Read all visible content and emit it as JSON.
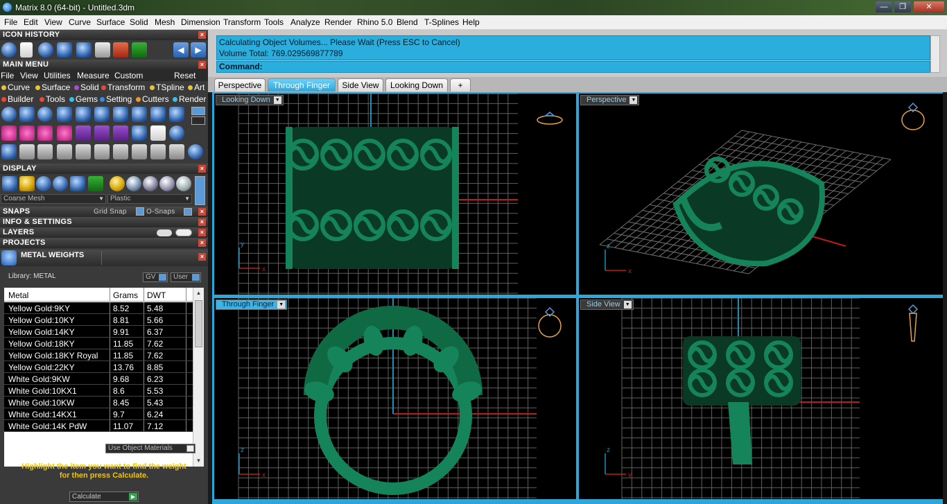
{
  "window": {
    "title": "Matrix 8.0 (64-bit) - Untitled.3dm",
    "controls": {
      "minimize": "—",
      "maximize": "❐",
      "close": "✕"
    }
  },
  "menubar": [
    "File",
    "Edit",
    "View",
    "Curve",
    "Surface",
    "Solid",
    "Mesh",
    "Dimension",
    "Transform",
    "Tools",
    "Analyze",
    "Render",
    "Rhino 5.0",
    "Blend",
    "T-Splines",
    "Help"
  ],
  "panels": {
    "icon_history": "ICON HISTORY",
    "main_menu": "MAIN MENU",
    "main_menu_items": [
      "File",
      "View",
      "Utilities",
      "Measure",
      "Custom"
    ],
    "reset": "Reset",
    "categories_row1": [
      {
        "label": "Curve",
        "color": "#e8c23a"
      },
      {
        "label": "Surface",
        "color": "#e8c23a"
      },
      {
        "label": "Solid",
        "color": "#b04ad0"
      },
      {
        "label": "Transform",
        "color": "#e84a3a"
      },
      {
        "label": "TSpline",
        "color": "#e8c23a"
      },
      {
        "label": "Art",
        "color": "#e8c23a"
      }
    ],
    "categories_row2": [
      {
        "label": "Builder",
        "color": "#e84a3a"
      },
      {
        "label": "Tools",
        "color": "#e84a3a"
      },
      {
        "label": "Gems",
        "color": "#3ac0e8"
      },
      {
        "label": "Setting",
        "color": "#3a8ae8"
      },
      {
        "label": "Cutters",
        "color": "#e89a3a"
      },
      {
        "label": "Render",
        "color": "#3ac0e8"
      }
    ],
    "display": "DISPLAY",
    "mesh_mode": "Coarse Mesh",
    "material_mode": "Plastic",
    "snaps": "SNAPS",
    "grid_snap": "Grid Snap",
    "o_snaps": "O-Snaps",
    "info_settings": "INFO & SETTINGS",
    "layers": "LAYERS",
    "projects": "PROJECTS",
    "metal_weights": "METAL WEIGHTS"
  },
  "metal_weights": {
    "library_label": "Library: METAL",
    "gv_label": "GV",
    "user_label": "User",
    "columns": [
      "Metal",
      "Grams",
      "DWT"
    ],
    "rows": [
      [
        "Yellow Gold:9KY",
        "8.52",
        "5.48"
      ],
      [
        "Yellow Gold:10KY",
        "8.81",
        "5.66"
      ],
      [
        "Yellow Gold:14KY",
        "9.91",
        "6.37"
      ],
      [
        "Yellow Gold:18KY",
        "11.85",
        "7.62"
      ],
      [
        "Yellow Gold:18KY Royal",
        "11.85",
        "7.62"
      ],
      [
        "Yellow Gold:22KY",
        "13.76",
        "8.85"
      ],
      [
        "White Gold:9KW",
        "9.68",
        "6.23"
      ],
      [
        "White Gold:10KX1",
        "8.6",
        "5.53"
      ],
      [
        "White Gold:10KW",
        "8.45",
        "5.43"
      ],
      [
        "White Gold:14KX1",
        "9.7",
        "6.24"
      ],
      [
        "White Gold:14K PdW",
        "11.07",
        "7.12"
      ]
    ],
    "use_object_materials": "Use Object Materials",
    "hint_line1": "Highlight the item you want to find the weight",
    "hint_line2": "for then press Calculate.",
    "calculate": "Calculate"
  },
  "command": {
    "line1": "Calculating Object Volumes... Please Wait (Press ESC to Cancel)",
    "line2": "Volume Total: 769.029569877789",
    "prompt": "Command:"
  },
  "tabs": [
    {
      "label": "Perspective",
      "active": false
    },
    {
      "label": "Through Finger",
      "active": true
    },
    {
      "label": "Side View",
      "active": false
    },
    {
      "label": "Looking Down",
      "active": false
    },
    {
      "label": "+",
      "active": false
    }
  ],
  "viewports": [
    {
      "label": "Looking Down",
      "active": false,
      "axes": [
        "y",
        "x"
      ]
    },
    {
      "label": "Perspective",
      "active": false,
      "axes": [
        "z",
        "y",
        "x"
      ]
    },
    {
      "label": "Through Finger",
      "active": true,
      "axes": [
        "z",
        "x"
      ]
    },
    {
      "label": "Side View",
      "active": false,
      "axes": [
        "z",
        "y"
      ]
    }
  ],
  "colors": {
    "command_bg": "#2aaede",
    "model_green": "#16845a",
    "active_tab": "#3cb3e6",
    "hint_text": "#f2c500"
  }
}
